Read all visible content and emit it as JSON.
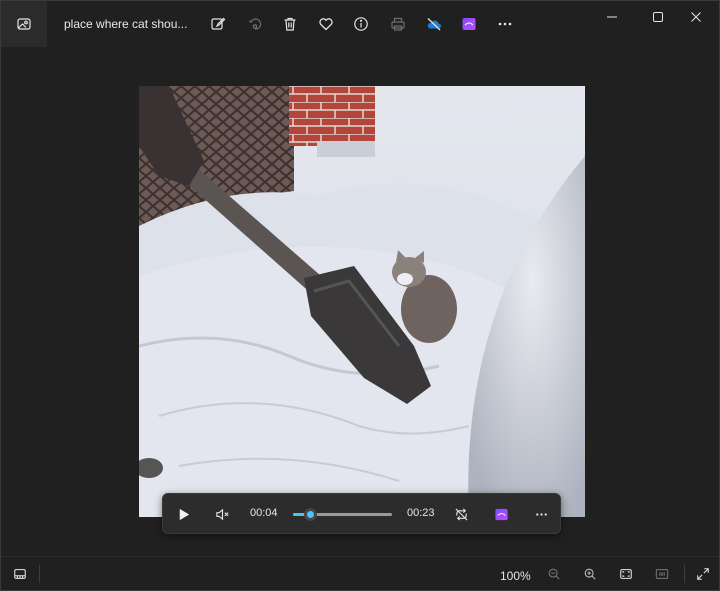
{
  "window": {
    "title": "place where cat shou...",
    "controls": [
      "minimize-icon",
      "maximize-icon",
      "close-icon"
    ]
  },
  "toolbar": {
    "items": [
      {
        "name": "edit-image-icon",
        "label": "Edit image"
      },
      {
        "name": "rotate-icon",
        "label": "Rotate",
        "disabled": true
      },
      {
        "name": "delete-icon",
        "label": "Delete"
      },
      {
        "name": "favorite-icon",
        "label": "Favorite"
      },
      {
        "name": "info-icon",
        "label": "File info"
      },
      {
        "name": "print-icon",
        "label": "Print",
        "disabled": true
      },
      {
        "name": "onedrive-off-icon",
        "label": "OneDrive"
      },
      {
        "name": "clipchamp-icon",
        "label": "Clipchamp"
      },
      {
        "name": "more-icon",
        "label": "See more"
      }
    ]
  },
  "player": {
    "current_time": "00:04",
    "duration": "00:23",
    "progress": 0.17,
    "controls": [
      "play-icon",
      "mute-icon",
      "loop-icon",
      "clipchamp-icon",
      "more-icon"
    ]
  },
  "statusbar": {
    "zoom": "100%",
    "items": [
      "filmstrip-icon",
      "zoom-out-icon",
      "zoom-in-icon",
      "fit-to-window-icon",
      "actual-size-icon",
      "fullscreen-icon"
    ]
  },
  "colors": {
    "background": "#202020",
    "accent": "#4cc2ff",
    "clipchamp_start": "#7b4dff",
    "clipchamp_end": "#c04dff"
  }
}
